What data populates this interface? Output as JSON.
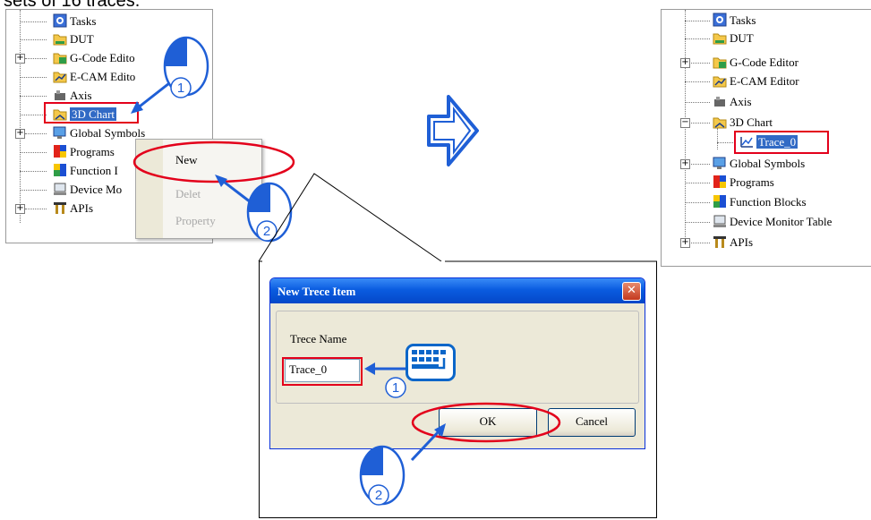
{
  "caption": "sets of 16 traces.",
  "left_tree": {
    "items": [
      {
        "label": "Tasks"
      },
      {
        "label": "DUT"
      },
      {
        "label": "G-Code Edito"
      },
      {
        "label": "E-CAM Edito"
      },
      {
        "label": "Axis"
      },
      {
        "label": "3D Chart"
      },
      {
        "label": "Global Symbols"
      },
      {
        "label": "Programs"
      },
      {
        "label": "Function I"
      },
      {
        "label": "Device Mo"
      },
      {
        "label": "APIs"
      }
    ]
  },
  "context_menu": {
    "items": [
      {
        "label": "New",
        "enabled": true
      },
      {
        "label": "Delet",
        "enabled": false
      },
      {
        "label": "Property",
        "enabled": false
      }
    ]
  },
  "step_badges": {
    "one": "①",
    "two": "②"
  },
  "right_tree": {
    "items": [
      {
        "label": "Tasks"
      },
      {
        "label": "DUT"
      },
      {
        "label": "G-Code Editor"
      },
      {
        "label": "E-CAM Editor"
      },
      {
        "label": "Axis"
      },
      {
        "label": "3D Chart"
      },
      {
        "label": "Trace_0"
      },
      {
        "label": "Global Symbols"
      },
      {
        "label": "Programs"
      },
      {
        "label": "Function Blocks"
      },
      {
        "label": "Device Monitor Table"
      },
      {
        "label": "APIs"
      }
    ]
  },
  "dialog": {
    "title": "New Trece Item",
    "close_symbol": "✕",
    "field_label": "Trece Name",
    "field_value": "Trace_0",
    "ok_label": "OK",
    "cancel_label": "Cancel"
  },
  "icons": {
    "folder": "folder-icon",
    "arrow_right": "big-arrow-right-icon",
    "mouse": "mouse-click-icon",
    "keyboard": "keyboard-icon"
  },
  "colors": {
    "highlight_red": "#e3001b",
    "arrow_blue": "#1f5fd6",
    "title_blue": "#0a5ce0"
  }
}
